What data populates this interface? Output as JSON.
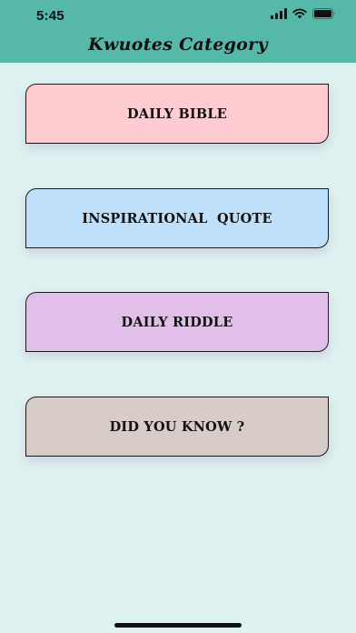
{
  "status_bar": {
    "time": "5:45"
  },
  "nav": {
    "title": "Kwuotes Category"
  },
  "categories": [
    {
      "label": "DAILY BIBLE",
      "color": "#ffcdd1"
    },
    {
      "label": "INSPIRATIONAL  QUOTE",
      "color": "#bfe0fa"
    },
    {
      "label": "DAILY RIDDLE",
      "color": "#e2bfe9"
    },
    {
      "label": "DID YOU KNOW ?",
      "color": "#d8ccc8"
    }
  ],
  "colors": {
    "header": "#55b8a8",
    "background": "#dff1f0"
  },
  "icons": [
    "cellular-signal-icon",
    "wifi-icon",
    "battery-icon"
  ]
}
